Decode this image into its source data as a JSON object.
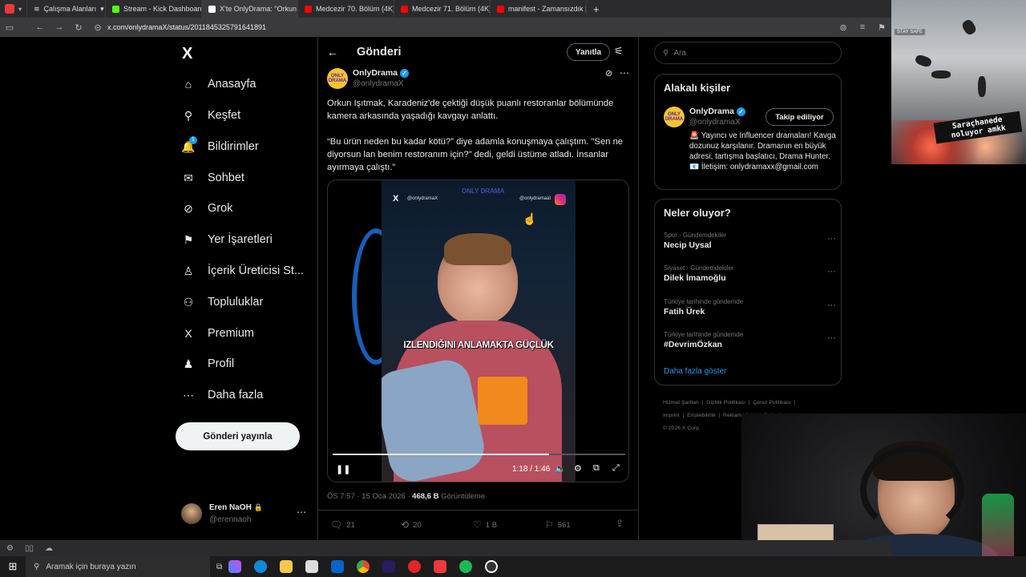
{
  "browser": {
    "tabs": [
      {
        "label": "Çalışma Alanları",
        "color": "#c0c0c0"
      },
      {
        "label": "Stream - Kick Dashboard",
        "color": "#53fc18"
      },
      {
        "label": "X'te OnlyDrama: \"Orkun Işı",
        "color": "#ffffff"
      },
      {
        "label": "Medcezir 70. Bölüm (4K) -",
        "color": "#ff0000"
      },
      {
        "label": "Medcezir 71. Bölüm (4K) -",
        "color": "#ff0000"
      },
      {
        "label": "manifest - Zamansızdık | O",
        "color": "#ff0000"
      }
    ],
    "new_tab": "+",
    "url": "x.com/onlydramaX/status/2011845325791641891"
  },
  "nav": {
    "logo": "X",
    "items": [
      {
        "label": "Anasayfa",
        "icon": "home-icon",
        "glyph": "⌂"
      },
      {
        "label": "Keşfet",
        "icon": "search-icon",
        "glyph": "⚲"
      },
      {
        "label": "Bildirimler",
        "icon": "bell-icon",
        "glyph": "🔔"
      },
      {
        "label": "Sohbet",
        "icon": "mail-icon",
        "glyph": "✉"
      },
      {
        "label": "Grok",
        "icon": "grok-icon",
        "glyph": "⊘"
      },
      {
        "label": "Yer İşaretleri",
        "icon": "bookmark-icon",
        "glyph": "⚑"
      },
      {
        "label": "İçerik Üreticisi St...",
        "icon": "creator-icon",
        "glyph": "♙"
      },
      {
        "label": "Topluluklar",
        "icon": "communities-icon",
        "glyph": "⚇"
      },
      {
        "label": "Premium",
        "icon": "x-premium-icon",
        "glyph": "X"
      },
      {
        "label": "Profil",
        "icon": "profile-icon",
        "glyph": "♟"
      },
      {
        "label": "Daha fazla",
        "icon": "more-circle-icon",
        "glyph": "⋯"
      }
    ],
    "notification_badge": "1",
    "post_button": "Gönderi yayınla",
    "user": {
      "name": "Eren NaOH",
      "handle": "@erennaoh"
    }
  },
  "header": {
    "title": "Gönderi",
    "reply_button": "Yanıtla"
  },
  "tweet": {
    "author": "OnlyDrama",
    "handle": "@onlydramaX",
    "text1": "Orkun Işıtmak, Karadeniz'de çektiği düşük puanlı restoranlar bölümünde kamera arkasında yaşadığı kavgayı anlattı.",
    "text2": "“Bu ürün neden bu kadar kötü?” diye adamla konuşmaya çalıştım. \"Sen ne diyorsun lan benim restoranım için?\" dedi, geldi üstüme atladı. İnsanlar ayırmaya çalıştı.”",
    "video": {
      "caption": "IZLENDIĞINI ANLAMAKTA GÜÇLÜK",
      "watermark_left": "@onlydramaX",
      "watermark_right": "@onlydramaat",
      "logo": "ONLY DRAMA",
      "time": "1:18 / 1:46",
      "progress": 0.74
    },
    "meta_time": "ÖS 7:57 · 15 Oca 2026 ·",
    "views": "468,6 B",
    "views_label": "Görüntüleme",
    "actions": {
      "replies": "21",
      "retweets": "20",
      "likes": "1 B",
      "bookmarks": "561"
    }
  },
  "right": {
    "search_placeholder": "Ara",
    "related": {
      "title": "Alakalı kişiler",
      "name": "OnlyDrama",
      "handle": "@onlydramaX",
      "follow": "Takip ediliyor",
      "bio": "🚨 Yayıncı ve Influencer dramaları! Kavga dozunuz karşılanır. Dramanın en büyük adresi, tartışma başlatıcı, Drama Hunter. 📧 İletişim: onlydramaxx@gmail.com"
    },
    "trends": {
      "title": "Neler oluyor?",
      "items": [
        {
          "context": "Spor · Gündemdekiler",
          "name": "Necip Uysal"
        },
        {
          "context": "Siyaset · Gündemdekiler",
          "name": "Dilek İmamoğlu"
        },
        {
          "context": "Türkiye tarihinde gündemde",
          "name": "Fatih Ürek"
        },
        {
          "context": "Türkiye tarihinde gündemde",
          "name": "#DevrimÖzkan"
        }
      ],
      "more": "Daha fazla göster"
    },
    "footer": {
      "line1": "Hizmet Şartları  |  Gizlilik Politikası  |  Çerez Politikası  |",
      "line2": "Imprint  |  Erişilebilirlik  |  Reklam bilgisi  |  Daha fazla ...",
      "line3": "© 2026 X Corp."
    }
  },
  "overlay": {
    "stay_safe": "STAY SAFE",
    "caption": "Saraçhanede noluyor amkk"
  },
  "taskbar": {
    "search_placeholder": "Aramak için buraya yazın"
  }
}
